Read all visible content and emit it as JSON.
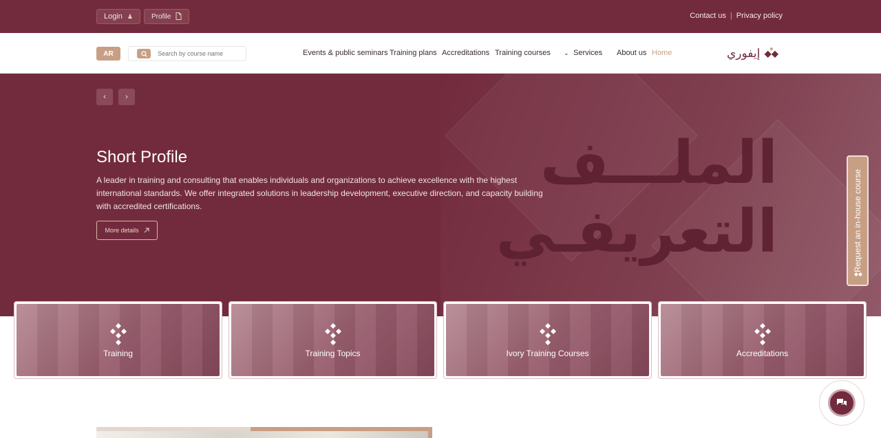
{
  "topbar": {
    "login_label": "Login",
    "profile_label": "Profile",
    "contact_label": "Contact us",
    "separator": "|",
    "privacy_label": "Privacy policy"
  },
  "navbar": {
    "lang_label": "AR",
    "search_placeholder": "Search by course name",
    "menu": [
      {
        "label": "Events & public seminars"
      },
      {
        "label": "Training plans"
      },
      {
        "label": "Accreditations"
      },
      {
        "label": "Training courses"
      },
      {
        "label": "Services"
      },
      {
        "label": "About us"
      },
      {
        "label": "Home"
      }
    ],
    "logo_text": "إيفوري"
  },
  "hero": {
    "title": "Short Profile",
    "description": "A leader in training and consulting that enables individuals and organizations to achieve excellence with the highest international standards. We offer integrated solutions in leadership development, executive direction, and capacity building with accredited certifications.",
    "more_label": "More details",
    "arabic_line1": "الملـــف",
    "arabic_line2": "التعريفـي",
    "prev_arrow": "‹",
    "next_arrow": "›"
  },
  "side_tab": {
    "label": "Request an in-house course"
  },
  "cards": [
    {
      "label": "Training"
    },
    {
      "label": "Training Topics"
    },
    {
      "label": "Ivory Training Courses"
    },
    {
      "label": "Accreditations"
    }
  ],
  "colors": {
    "brand": "#722b3d",
    "accent": "#c79f85"
  }
}
